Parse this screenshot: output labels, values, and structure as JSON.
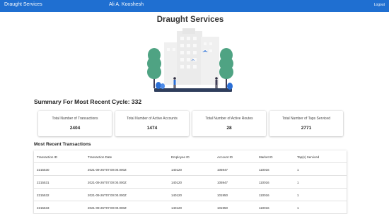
{
  "navbar": {
    "brand": "Draught Services",
    "user": "Ali A. Kooshesh",
    "logout": "Logout"
  },
  "page": {
    "title": "Draught Services"
  },
  "summary": {
    "heading": "Summary For Most Recent Cycle: 332",
    "cards": [
      {
        "label": "Total Number of Transactions",
        "value": "2404"
      },
      {
        "label": "Total Number of Active Accounts",
        "value": "1474"
      },
      {
        "label": "Total Number of Active Routes",
        "value": "28"
      },
      {
        "label": "Total Number of Taps Serviced",
        "value": "2771"
      }
    ]
  },
  "transactions": {
    "heading": "Most Recent Transactions",
    "columns": [
      "Transaction ID",
      "Transaction Date",
      "Employee ID",
      "Account ID",
      "Market ID",
      "Tap(s) Serviced"
    ],
    "rows": [
      [
        "2215530",
        "2021-09-26T07:00:00.000Z",
        "140120",
        "105947",
        "110016",
        "1"
      ],
      [
        "2215531",
        "2021-09-26T07:00:00.000Z",
        "140120",
        "105947",
        "110016",
        "1"
      ],
      [
        "2215532",
        "2021-09-26T07:00:00.000Z",
        "140120",
        "101950",
        "110016",
        "1"
      ],
      [
        "2215533",
        "2021-09-26T07:00:00.000Z",
        "140120",
        "101950",
        "110016",
        "1"
      ]
    ]
  },
  "colors": {
    "navbar": "#1f6fd1",
    "tree": "#4fa383",
    "building": "#eeeeee",
    "platform": "#2f3e5c",
    "accent": "#2b6fd6"
  }
}
